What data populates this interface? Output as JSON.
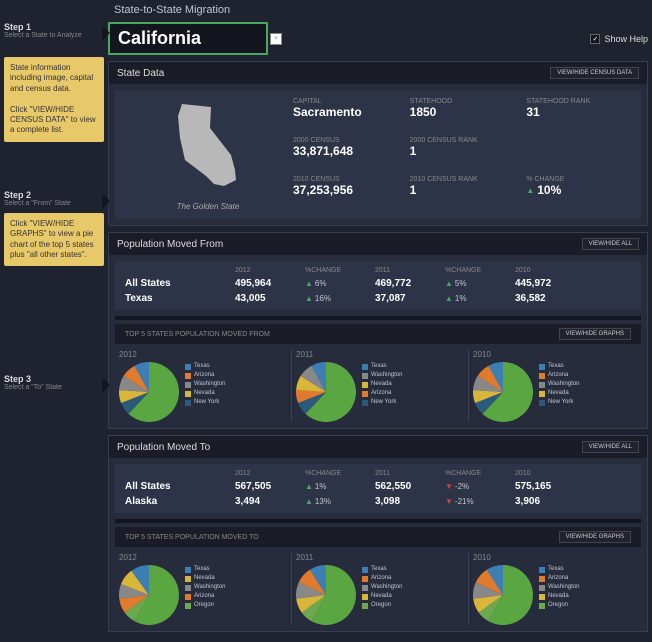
{
  "title": "State-to-State Migration",
  "steps": [
    {
      "label": "Step 1",
      "sub": "Select a State to Analyze"
    },
    {
      "label": "Step 2",
      "sub": "Select a \"From\" State"
    },
    {
      "label": "Step 3",
      "sub": "Select a \"To\" State"
    }
  ],
  "notes": [
    "State information including image, capital and census data.\n\nClick \"VIEW/HIDE CENSUS DATA\" to view a complete list.",
    "Click \"VIEW/HIDE GRAPHS\" to view a pie chart of the top 5 states plus \"all other states\"."
  ],
  "selected_state": "California",
  "show_help": "Show Help",
  "buttons": {
    "view_census": "VIEW/HIDE CENSUS DATA",
    "view_all": "VIEW/HIDE ALL",
    "view_graphs": "VIEW/HIDE GRAPHS"
  },
  "state_data": {
    "header": "State Data",
    "motto": "The Golden State",
    "stats": {
      "capital": {
        "label": "CAPITAL",
        "value": "Sacramento"
      },
      "statehood": {
        "label": "STATEHOOD",
        "value": "1850"
      },
      "statehood_rank": {
        "label": "STATEHOOD RANK",
        "value": "31"
      },
      "census2000": {
        "label": "2000 CENSUS",
        "value": "33,871,648"
      },
      "census2000rank": {
        "label": "2000 CENSUS RANK",
        "value": "1"
      },
      "census2010": {
        "label": "2010 CENSUS",
        "value": "37,253,956"
      },
      "census2010rank": {
        "label": "2010 CENSUS RANK",
        "value": "1"
      },
      "pctchange": {
        "label": "% CHANGE",
        "value": "10%"
      }
    }
  },
  "moved_from": {
    "header": "Population Moved From",
    "cols": [
      "2012",
      "%CHANGE",
      "2011",
      "%CHANGE",
      "2010"
    ],
    "rows": [
      {
        "label": "All States",
        "v2012": "495,964",
        "c1": "6%",
        "d1": "up",
        "v2011": "469,772",
        "c2": "5%",
        "d2": "up",
        "v2010": "445,972"
      },
      {
        "label": "Texas",
        "v2012": "43,005",
        "c1": "16%",
        "d1": "up",
        "v2011": "37,087",
        "c2": "1%",
        "d2": "up",
        "v2010": "36,582"
      }
    ],
    "charts_title": "TOP 5 STATES POPULATION MOVED FROM"
  },
  "moved_to": {
    "header": "Population Moved To",
    "cols": [
      "2012",
      "%CHANGE",
      "2011",
      "%CHANGE",
      "2010"
    ],
    "rows": [
      {
        "label": "All States",
        "v2012": "567,505",
        "c1": "1%",
        "d1": "up",
        "v2011": "562,550",
        "c2": "-2%",
        "d2": "down",
        "v2010": "575,165"
      },
      {
        "label": "Alaska",
        "v2012": "3,494",
        "c1": "13%",
        "d1": "up",
        "v2011": "3,098",
        "c2": "-21%",
        "d2": "down",
        "v2010": "3,906"
      }
    ],
    "charts_title": "TOP 5 STATES POPULATION MOVED TO"
  },
  "chart_data": {
    "type": "pie",
    "colors": {
      "Texas": "#3b7fb5",
      "Arizona": "#e07b2e",
      "Washington": "#888",
      "Nevada": "#d8b63a",
      "New York": "#2b5a7a",
      "Oregon": "#6ba84f",
      "Other": "#5aa640"
    },
    "moved_from": [
      {
        "year": "2012",
        "legend": [
          "Texas",
          "Arizona",
          "Washington",
          "Nevada",
          "New York"
        ],
        "slices": [
          {
            "name": "Other",
            "value": 62
          },
          {
            "name": "New York",
            "value": 7
          },
          {
            "name": "Nevada",
            "value": 7
          },
          {
            "name": "Washington",
            "value": 8
          },
          {
            "name": "Arizona",
            "value": 8
          },
          {
            "name": "Texas",
            "value": 8
          }
        ]
      },
      {
        "year": "2011",
        "legend": [
          "Texas",
          "Washington",
          "Nevada",
          "Arizona",
          "New York"
        ],
        "slices": [
          {
            "name": "Other",
            "value": 62
          },
          {
            "name": "New York",
            "value": 7
          },
          {
            "name": "Arizona",
            "value": 7
          },
          {
            "name": "Nevada",
            "value": 8
          },
          {
            "name": "Washington",
            "value": 8
          },
          {
            "name": "Texas",
            "value": 8
          }
        ]
      },
      {
        "year": "2010",
        "legend": [
          "Texas",
          "Arizona",
          "Washington",
          "Nevada",
          "New York"
        ],
        "slices": [
          {
            "name": "Other",
            "value": 62
          },
          {
            "name": "New York",
            "value": 7
          },
          {
            "name": "Nevada",
            "value": 7
          },
          {
            "name": "Washington",
            "value": 8
          },
          {
            "name": "Arizona",
            "value": 8
          },
          {
            "name": "Texas",
            "value": 8
          }
        ]
      }
    ],
    "moved_to": [
      {
        "year": "2012",
        "legend": [
          "Texas",
          "Nevada",
          "Washington",
          "Arizona",
          "Oregon"
        ],
        "slices": [
          {
            "name": "Other",
            "value": 58
          },
          {
            "name": "Oregon",
            "value": 7
          },
          {
            "name": "Arizona",
            "value": 8
          },
          {
            "name": "Washington",
            "value": 8
          },
          {
            "name": "Nevada",
            "value": 9
          },
          {
            "name": "Texas",
            "value": 10
          }
        ]
      },
      {
        "year": "2011",
        "legend": [
          "Texas",
          "Arizona",
          "Washington",
          "Nevada",
          "Oregon"
        ],
        "slices": [
          {
            "name": "Other",
            "value": 58
          },
          {
            "name": "Oregon",
            "value": 7
          },
          {
            "name": "Nevada",
            "value": 8
          },
          {
            "name": "Washington",
            "value": 9
          },
          {
            "name": "Arizona",
            "value": 9
          },
          {
            "name": "Texas",
            "value": 9
          }
        ]
      },
      {
        "year": "2010",
        "legend": [
          "Texas",
          "Arizona",
          "Washington",
          "Nevada",
          "Oregon"
        ],
        "slices": [
          {
            "name": "Other",
            "value": 58
          },
          {
            "name": "Oregon",
            "value": 7
          },
          {
            "name": "Nevada",
            "value": 8
          },
          {
            "name": "Washington",
            "value": 9
          },
          {
            "name": "Arizona",
            "value": 9
          },
          {
            "name": "Texas",
            "value": 9
          }
        ]
      }
    ]
  }
}
